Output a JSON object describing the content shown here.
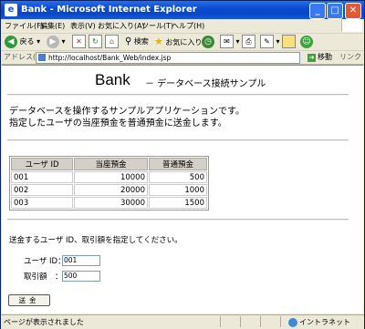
{
  "window": {
    "title": "Bank - Microsoft Internet Explorer",
    "minimize": "_",
    "maximize": "□",
    "close": "✕"
  },
  "menu": [
    "ファイル(F)",
    "編集(E)",
    "表示(V)",
    "お気に入り(A)",
    "ツール(T)",
    "ヘルプ(H)"
  ],
  "toolbar": {
    "back_label": "戻る",
    "search_label": "検索",
    "favorites_label": "お気に入り"
  },
  "address": {
    "label": "アドレス(D)",
    "url": "http://localhost/Bank_Web/index.jsp",
    "go_label": "移動",
    "links_label": "リンク"
  },
  "page": {
    "heading": "Bank",
    "subheading": "－ データベース接続サンプル",
    "description_line1": "データベースを操作するサンプルアプリケーションです。",
    "description_line2": "指定したユーザの当座預金を普通預金に送金します。",
    "table": {
      "headers": [
        "ユーザ ID",
        "当座預金",
        "普通預金"
      ],
      "rows": [
        [
          "001",
          "10000",
          "500"
        ],
        [
          "002",
          "20000",
          "1000"
        ],
        [
          "003",
          "30000",
          "1500"
        ]
      ]
    },
    "prompt": "送金するユーザ ID、取引額を指定してください。",
    "form": {
      "user_id_label": "ユーザ ID：",
      "user_id_value": "001",
      "amount_label": "取引額　：",
      "amount_value": "500",
      "submit_label": "送金"
    }
  },
  "status": {
    "text": "ページが表示されました",
    "zone": "イントラネット"
  },
  "colors": {
    "titlebar": "#0a4cd0",
    "chrome": "#ece9d8",
    "table_header": "#d4d0c8"
  }
}
